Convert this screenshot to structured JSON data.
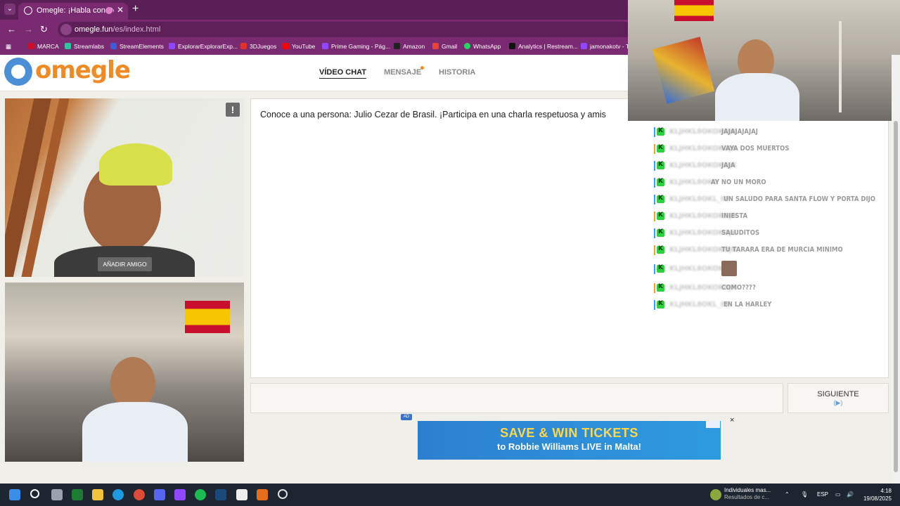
{
  "browser": {
    "tab_title": "Omegle: ¡Habla con Desconocidos!",
    "url_host": "omegle.fun",
    "url_path": "/es/index.html",
    "bookmarks": [
      {
        "label": "MARCA",
        "color": "#c8102e"
      },
      {
        "label": "Streamlabs",
        "color": "#31c3a2"
      },
      {
        "label": "StreamElements",
        "color": "#3b5bdb"
      },
      {
        "label": "ExplorarExplorarExp...",
        "color": "#9146ff"
      },
      {
        "label": "3DJuegos",
        "color": "#e03131"
      },
      {
        "label": "YouTube",
        "color": "#ff0000"
      },
      {
        "label": "Prime Gaming - Pág...",
        "color": "#9146ff"
      },
      {
        "label": "Amazon",
        "color": "#222222"
      },
      {
        "label": "Gmail",
        "color": "#ea4335"
      },
      {
        "label": "WhatsApp",
        "color": "#25d366"
      },
      {
        "label": "Analytics | Restream...",
        "color": "#111111"
      },
      {
        "label": "jamonakotv - T...",
        "color": "#9146ff"
      }
    ]
  },
  "site": {
    "logo": "omegle",
    "nav": [
      {
        "label": "VÍDEO CHAT",
        "active": true
      },
      {
        "label": "MENSAJE",
        "active": false
      },
      {
        "label": "HISTORIA",
        "active": false
      }
    ]
  },
  "video": {
    "report_label": "!",
    "add_friend_label": "AÑADIR AMIGO"
  },
  "chat": {
    "intro": "Conoce a una persona: Julio Cezar de Brasil. ¡Participa en una charla respetuosa y amis",
    "next_label": "SIGUIENTE",
    "next_hint": "(▶)"
  },
  "overlay_chat": [
    {
      "user": "KLJHKL8OKOKOJK",
      "text": "JAJAJAJAJAJ",
      "bar": "#3aa0ff"
    },
    {
      "user": "KLJHKL8OKOKOJK",
      "text": "VAYA DOS MUERTOS",
      "bar": "#f0a030"
    },
    {
      "user": "KLJHKL8OKOKOJK",
      "text": "JAJA",
      "bar": "#3aa0ff"
    },
    {
      "user": "KLJHKL8OKO",
      "text": "AY NO UN MORO",
      "bar": "#3aa0ff"
    },
    {
      "user": "KLJHKL8OKL_08",
      "text": "UN SALUDO PARA SANTA FLOW Y PORTA DIJO",
      "bar": "#3aa0ff"
    },
    {
      "user": "KLJHKL8OKOKOJK",
      "text": "INIESTA",
      "bar": "#f0a030"
    },
    {
      "user": "KLJHKL8OKOKOJK",
      "text": "SALUDITOS",
      "bar": "#3aa0ff"
    },
    {
      "user": "KLJHKL8OKOKOJK",
      "text": "TU TARARA ERA DE MURCIA MINIMO",
      "bar": "#f0a030"
    },
    {
      "user": "KLJHKL8OKOKOJK",
      "text": "",
      "bar": "#3aa0ff",
      "emote": true
    },
    {
      "user": "KLJHKL8OKOKOJK",
      "text": "COMO????",
      "bar": "#f0a030"
    },
    {
      "user": "KLJHKL8OKL_08",
      "text": "EN LA HARLEY",
      "bar": "#3aa0ff"
    }
  ],
  "ad": {
    "tag": "AD",
    "headline": "SAVE & WIN TICKETS",
    "subline": "to Robbie Williams LIVE in Malta!",
    "close": "×"
  },
  "taskbar": {
    "news_title": "Individuales mas...",
    "news_sub": "Resultados de c...",
    "lang": "ESP",
    "time": "4:18",
    "date": "19/08/2025"
  },
  "colors": {
    "browser_dark": "#5b1f57",
    "browser_mid": "#7a2a70",
    "logo_orange": "#f08a24",
    "logo_blue": "#4c8fd6",
    "kick_green": "#2bd13a"
  }
}
